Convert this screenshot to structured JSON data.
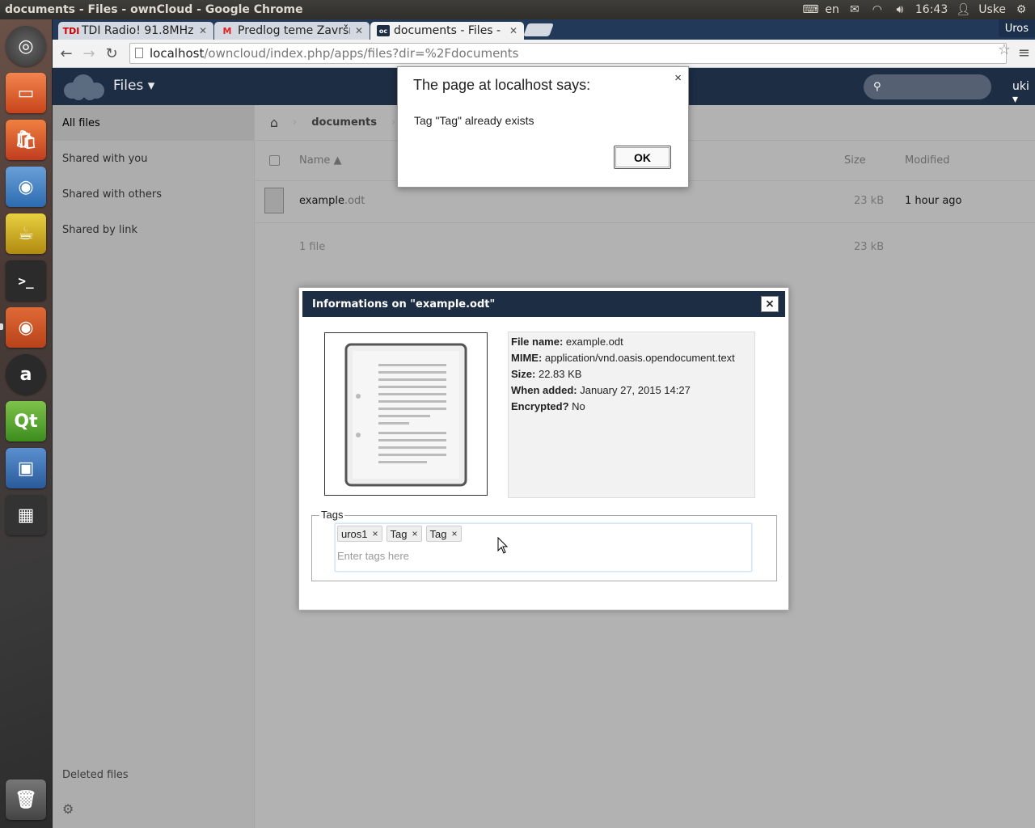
{
  "os": {
    "window_title": "documents - Files - ownCloud - Google Chrome",
    "keyboard_lang": "en",
    "clock": "16:43",
    "user": "Uske"
  },
  "browser": {
    "tabs": [
      {
        "label": "TDI Radio! 91.8MHz",
        "favicon": "TDI"
      },
      {
        "label": "Predlog teme Završnog",
        "favicon": "M"
      },
      {
        "label": "documents - Files - o",
        "favicon": "oc"
      }
    ],
    "profile": "Uros",
    "url_host": "localhost",
    "url_rest": "/owncloud/index.php/apps/files?dir=%2Fdocuments"
  },
  "owncloud": {
    "app_name": "Files ▾",
    "user_menu": "uki ▾",
    "sidebar": {
      "items": [
        {
          "label": "All files"
        },
        {
          "label": "Shared with you"
        },
        {
          "label": "Shared with others"
        },
        {
          "label": "Shared by link"
        }
      ],
      "deleted": "Deleted files"
    },
    "breadcrumb": "documents",
    "table": {
      "col_name": "Name ▲",
      "col_size": "Size",
      "col_modified": "Modified",
      "rows": [
        {
          "name": "example",
          "ext": ".odt",
          "size": "23 kB",
          "modified": "1 hour ago"
        }
      ],
      "summary_count": "1 file",
      "summary_size": "23 kB"
    }
  },
  "info_dialog": {
    "title": "Informations on \"example.odt\"",
    "close": "×",
    "meta": {
      "file_name_label": "File name:",
      "file_name": "example.odt",
      "mime_label": "MIME:",
      "mime": "application/vnd.oasis.opendocument.text",
      "size_label": "Size:",
      "size": "22.83 KB",
      "added_label": "When added:",
      "added": "January 27, 2015 14:27",
      "encrypted_label": "Encrypted?",
      "encrypted": "No"
    },
    "tags_legend": "Tags",
    "tags": [
      {
        "label": "uros1",
        "x": "×"
      },
      {
        "label": "Tag",
        "x": "×"
      },
      {
        "label": "Tag",
        "x": "×"
      }
    ],
    "tags_placeholder": "Enter tags here"
  },
  "alert": {
    "title": "The page at localhost says:",
    "message": "Tag \"Tag\" already exists",
    "ok": "OK",
    "close": "×"
  }
}
